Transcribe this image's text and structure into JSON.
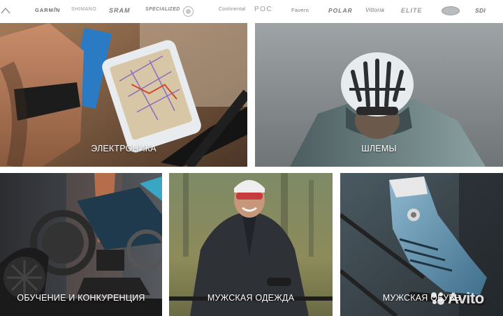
{
  "brands": {
    "garmin": "GARMIN",
    "shimano": "SHIMANO",
    "sram": "SRAM",
    "specialized": "SPECIALIZED",
    "continental": "Continental",
    "poc": "POC",
    "favero": "Favero",
    "polar": "POLAR",
    "vittoria": "Vittoria",
    "elite": "ELITE",
    "sdi": "SDI"
  },
  "tiles": {
    "electronics": "ЭЛЕКТРОНИКА",
    "helmets": "ШЛЕМЫ",
    "training": "ОБУЧЕНИЕ И КОНКУРЕНЦИЯ",
    "clothing": "МУЖСКАЯ ОДЕЖДА",
    "shoes": "МУЖСКАЯ ОБУВЬ"
  },
  "watermark": {
    "text": "Avito"
  },
  "colors": {
    "caption": "#ffffff",
    "brand_text": "#8a8a8a",
    "background": "#ffffff"
  }
}
